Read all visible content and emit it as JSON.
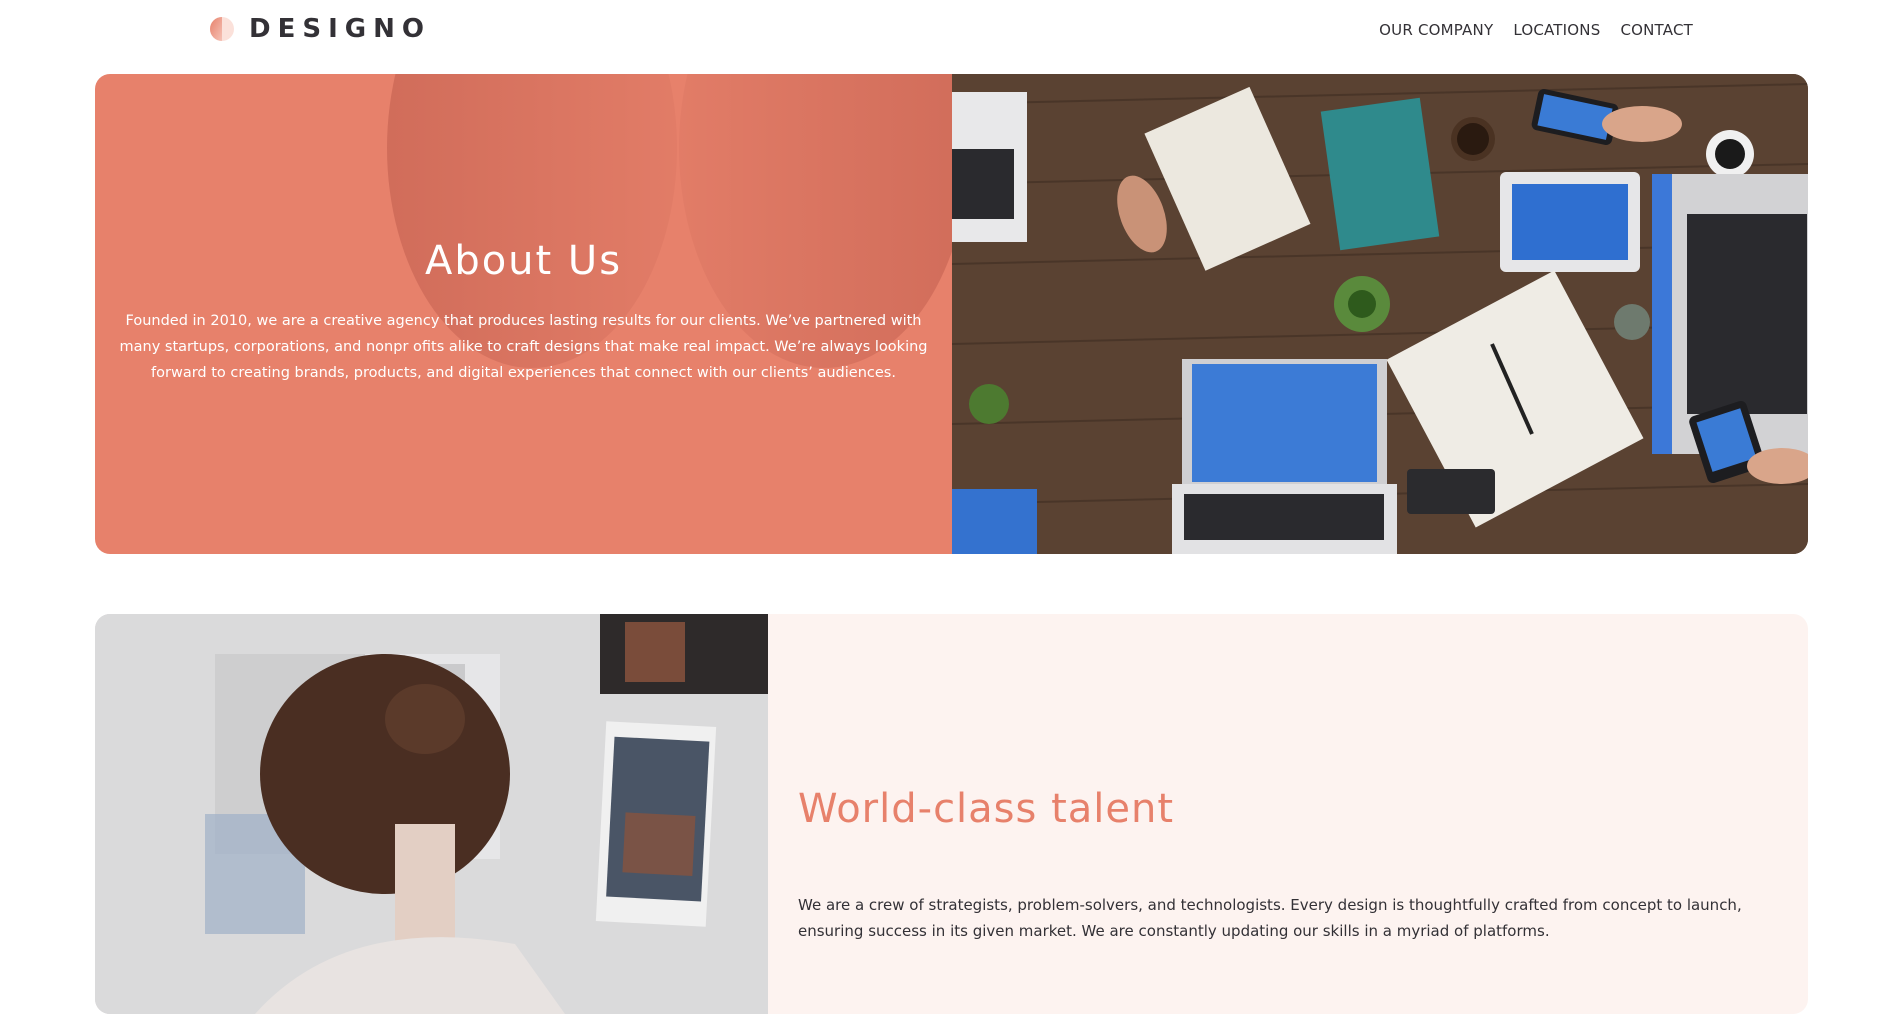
{
  "header": {
    "logo_text": "DESIGNO",
    "nav": [
      {
        "label": "OUR COMPANY"
      },
      {
        "label": "LOCATIONS"
      },
      {
        "label": "CONTACT"
      }
    ]
  },
  "about": {
    "title": "About Us",
    "text": "Founded in 2010, we are a creative agency that produces lasting results for our clients. We’ve partnered with many startups, corporations, and nonpr ofits alike to craft designs that make real impact. We’re always looking forward to creating brands, products, and digital experiences that connect with our clients’ audiences.",
    "image_alt": "team working at a wooden table with laptops and notebooks"
  },
  "talent": {
    "title": "World-class talent",
    "text": "We are a crew of strategists, problem-solvers, and technologists. Every design is thoughtfully crafted from concept to launch, ensuring success in its given market. We are constantly updating our skills in a myriad of platforms.",
    "image_alt": "woman looking at photos pinned to a wall"
  },
  "colors": {
    "accent": "#e7816b",
    "dark": "#333136",
    "light_peach": "#fdf3f0"
  }
}
